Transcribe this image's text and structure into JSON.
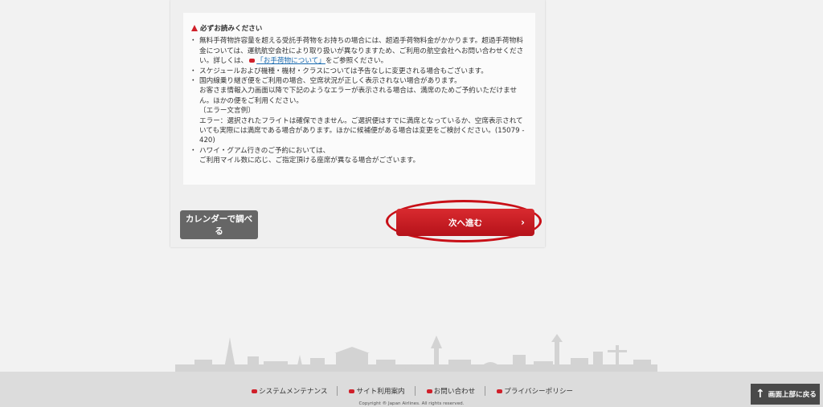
{
  "notice": {
    "title": "必ずお読みください",
    "item1_text": "無料手荷物許容量を超える受託手荷物をお持ちの場合には、超過手荷物料金がかかります。超過手荷物料金については、運航航空会社により取り扱いが異なりますため、ご利用の航空会社へお問い合わせください。詳しくは、",
    "item1_link": "「お手荷物について」",
    "item1_after": "をご参照ください。",
    "item2_text": "スケジュールおよび機種・機材・クラスについては予告なしに変更される場合もございます。",
    "item3_text": "国内線乗り継ぎ便をご利用の場合、空席状況が正しく表示されない場合があります。",
    "item3_sub1": "お客さま情報入力画面以降で下記のようなエラーが表示される場合は、満席のためご予約いただけません。ほかの便をご利用ください。",
    "item3_sub2": "〔エラー文言例〕",
    "item3_sub3": "エラー：選択されたフライトは確保できません。ご選択便はすでに満席となっているか、空席表示されていても実際には満席である場合があります。ほかに候補便がある場合は変更をご検討ください。(15079 - 420)",
    "item4_text": "ハワイ・グアム行きのご予約においては、",
    "item4_sub1": "ご利用マイル数に応じ、ご指定頂ける座席が異なる場合がございます。"
  },
  "buttons": {
    "calendar_label": "カレンダーで調べる",
    "next_label": "次へ進む",
    "next_chevron": "›"
  },
  "footer": {
    "links": [
      "システムメンテナンス",
      "サイト利用案内",
      "お問い合わせ",
      "プライバシーポリシー"
    ],
    "copyright": "Copyright ® Japan Airlines. All rights reserved.",
    "back_to_top": "画面上部に戻る"
  },
  "colors": {
    "accent_red": "#d0202a",
    "button_gray": "#666666",
    "link_blue": "#1a6bb0"
  }
}
